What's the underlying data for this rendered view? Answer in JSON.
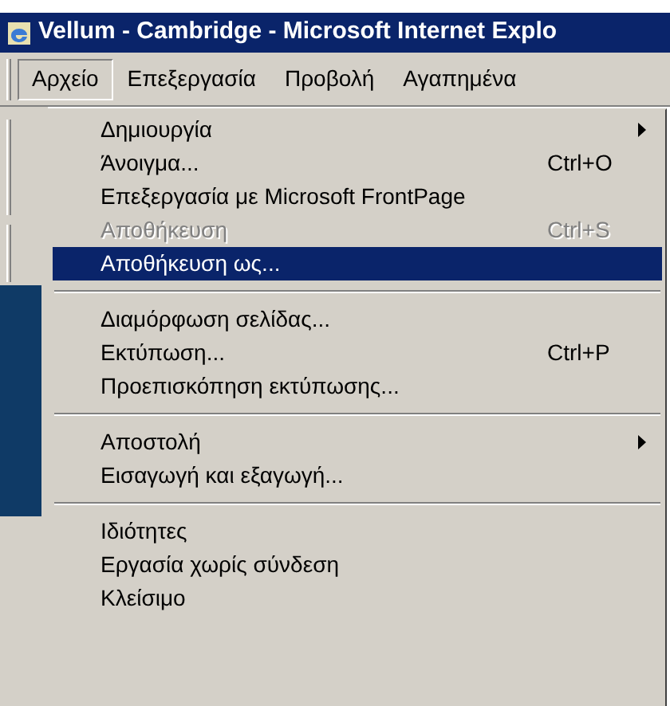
{
  "window": {
    "title": "Vellum - Cambridge - Microsoft Internet Explo"
  },
  "menubar": [
    {
      "label": "Αρχείο",
      "selected": true
    },
    {
      "label": "Επεξεργασία",
      "selected": false
    },
    {
      "label": "Προβολή",
      "selected": false
    },
    {
      "label": "Αγαπημένα",
      "selected": false
    }
  ],
  "menu": [
    {
      "kind": "item",
      "label": "Δημιουργία",
      "submenu": true,
      "disabled": false,
      "selected": false
    },
    {
      "kind": "item",
      "label": "Άνοιγμα...",
      "shortcut": "Ctrl+O",
      "submenu": false,
      "disabled": false,
      "selected": false
    },
    {
      "kind": "item",
      "label": "Επεξεργασία με Microsoft FrontPage",
      "submenu": false,
      "disabled": false,
      "selected": false
    },
    {
      "kind": "item",
      "label": "Αποθήκευση",
      "shortcut": "Ctrl+S",
      "submenu": false,
      "disabled": true,
      "selected": false
    },
    {
      "kind": "item",
      "label": "Αποθήκευση ως...",
      "submenu": false,
      "disabled": false,
      "selected": true
    },
    {
      "kind": "separator"
    },
    {
      "kind": "item",
      "label": "Διαμόρφωση σελίδας...",
      "submenu": false,
      "disabled": false,
      "selected": false
    },
    {
      "kind": "item",
      "label": "Εκτύπωση...",
      "shortcut": "Ctrl+P",
      "submenu": false,
      "disabled": false,
      "selected": false
    },
    {
      "kind": "item",
      "label": "Προεπισκόπηση εκτύπωσης...",
      "submenu": false,
      "disabled": false,
      "selected": false
    },
    {
      "kind": "separator"
    },
    {
      "kind": "item",
      "label": "Αποστολή",
      "submenu": true,
      "disabled": false,
      "selected": false
    },
    {
      "kind": "item",
      "label": "Εισαγωγή και εξαγωγή...",
      "submenu": false,
      "disabled": false,
      "selected": false
    },
    {
      "kind": "separator"
    },
    {
      "kind": "item",
      "label": "Ιδιότητες",
      "submenu": false,
      "disabled": false,
      "selected": false
    },
    {
      "kind": "item",
      "label": "Εργασία χωρίς σύνδεση",
      "submenu": false,
      "disabled": false,
      "selected": false
    },
    {
      "kind": "item",
      "label": "Κλείσιμο",
      "submenu": false,
      "disabled": false,
      "selected": false
    }
  ]
}
